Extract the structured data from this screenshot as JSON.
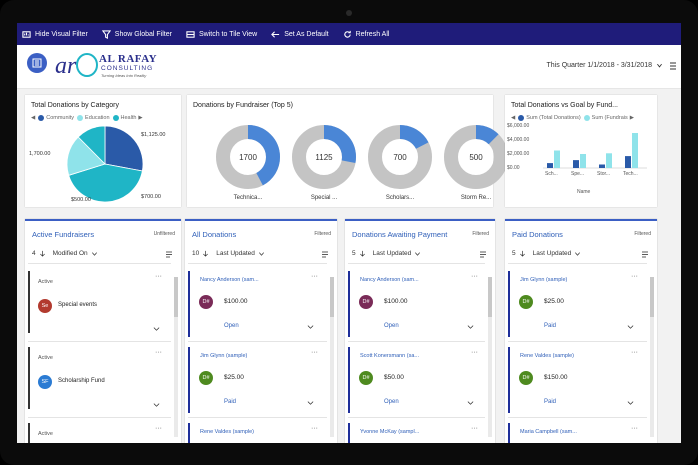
{
  "toolbar": {
    "hide_visual_filter": "Hide Visual Filter",
    "show_global_filter": "Show Global Filter",
    "switch_to_tile_view": "Switch to Tile View",
    "set_as_default": "Set As Default",
    "refresh_all": "Refresh All"
  },
  "header": {
    "logo_name": "AL RAFAY",
    "logo_sub": "CONSULTING",
    "logo_tagline": "Turning Ideas Into Reality",
    "date_range": "This Quarter 1/1/2018 - 3/31/2018"
  },
  "colors": {
    "accent": "#1f1c7a",
    "link": "#2f5fb8",
    "teal": "#1fb5c6",
    "navy": "#2a5aa8",
    "light_teal": "#8fe3ea"
  },
  "chart_data": [
    {
      "type": "pie",
      "title": "Total Donations by Category",
      "legend": [
        "Community",
        "Education",
        "Health"
      ],
      "labels": [
        "$1,125.00",
        "1,700.00",
        "$700.00",
        "$500.00"
      ],
      "values": [
        1125,
        1700,
        700,
        500
      ]
    },
    {
      "type": "pie",
      "title": "Donations by Fundraiser (Top 5)",
      "categories": [
        "Technica...",
        "Special ...",
        "Scholars...",
        "Storm Re..."
      ],
      "values": [
        1700,
        1125,
        700,
        500
      ]
    },
    {
      "type": "bar",
      "title": "Total Donations vs Goal by Fund...",
      "legend": [
        "Sum (Total Donations)",
        "Sum (Fundrais"
      ],
      "categories": [
        "Sch...",
        "Spe...",
        "Stor...",
        "Tech..."
      ],
      "xlabel": "Name",
      "yticks": [
        "$6,000.00",
        "$4,000.00",
        "$2,000.00",
        "$0.00"
      ],
      "ylim": [
        0,
        6000
      ],
      "series": [
        {
          "name": "Sum (Total Donations)",
          "values": [
            700,
            1125,
            500,
            1700
          ]
        },
        {
          "name": "Sum (Fundrais",
          "values": [
            2500,
            2000,
            2100,
            5000
          ]
        }
      ]
    }
  ],
  "lists": [
    {
      "title": "Active Fundraisers",
      "filter": "Unfiltered",
      "count": "4",
      "sort": "Modified On",
      "items": [
        {
          "status": "Active",
          "initials": "Se",
          "name": "Special events",
          "color": "#b23a2e"
        },
        {
          "status": "Active",
          "initials": "SF",
          "name": "Scholarship Fund",
          "color": "#2b7bd3"
        },
        {
          "status": "Active",
          "initials": "",
          "name": "",
          "color": "#999"
        }
      ]
    },
    {
      "title": "All Donations",
      "filter": "Filtered",
      "count": "10",
      "sort": "Last Updated",
      "items": [
        {
          "name": "Nancy Anderson (sam...",
          "initials": "D#",
          "amount": "$100.00",
          "status": "Open",
          "color": "#7a2b58"
        },
        {
          "name": "Jim Glynn (sample)",
          "initials": "D#",
          "amount": "$25.00",
          "status": "Paid",
          "color": "#4e8a1f"
        },
        {
          "name": "Rene Valdes (sample)",
          "initials": "",
          "amount": "",
          "status": "",
          "color": "#999"
        }
      ]
    },
    {
      "title": "Donations Awaiting Payment",
      "filter": "Filtered",
      "count": "5",
      "sort": "Last Updated",
      "items": [
        {
          "name": "Nancy Anderson (sam...",
          "initials": "D#",
          "amount": "$100.00",
          "status": "Open",
          "color": "#7a2b58"
        },
        {
          "name": "Scott Konersmann (sa...",
          "initials": "D#",
          "amount": "$50.00",
          "status": "Open",
          "color": "#4e8a1f"
        },
        {
          "name": "Yvonne McKay (sampl...",
          "initials": "",
          "amount": "",
          "status": "",
          "color": "#999"
        }
      ]
    },
    {
      "title": "Paid Donations",
      "filter": "Filtered",
      "count": "5",
      "sort": "Last Updated",
      "items": [
        {
          "name": "Jim Glynn (sample)",
          "initials": "D#",
          "amount": "$25.00",
          "status": "Paid",
          "color": "#4e8a1f"
        },
        {
          "name": "Rene Valdes (sample)",
          "initials": "D#",
          "amount": "$150.00",
          "status": "Paid",
          "color": "#4e8a1f"
        },
        {
          "name": "Maria Campbell (sam...",
          "initials": "",
          "amount": "",
          "status": "",
          "color": "#999"
        }
      ]
    }
  ]
}
